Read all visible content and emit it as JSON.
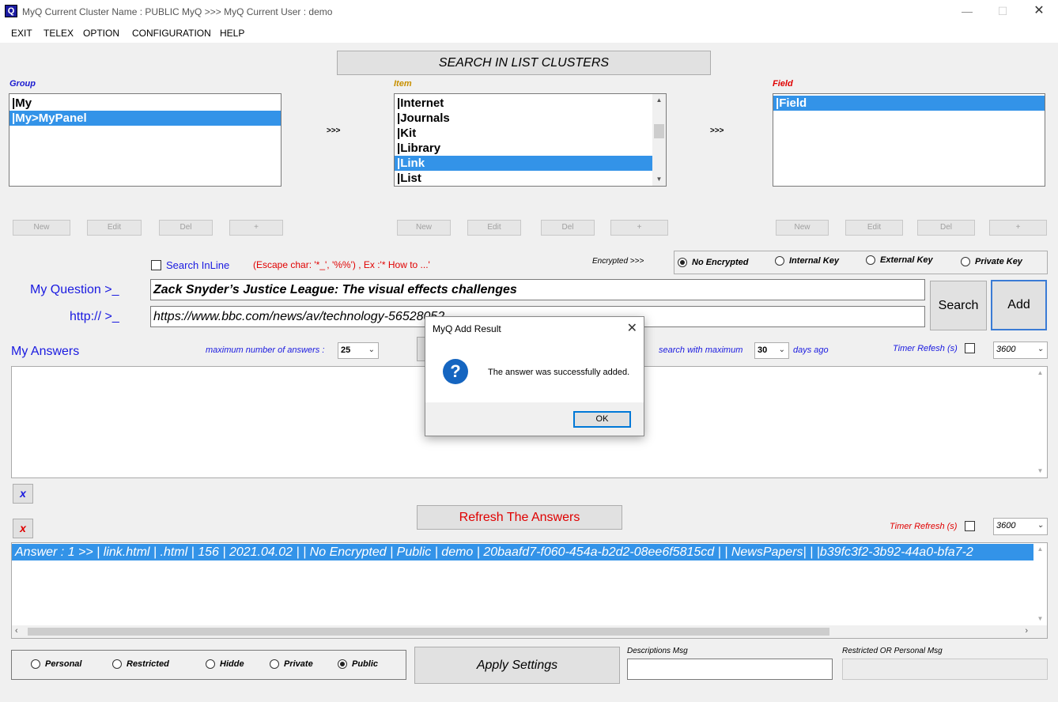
{
  "window": {
    "title": "MyQ Current Cluster Name : PUBLIC MyQ >>> MyQ Current User : demo",
    "app_icon": "Q"
  },
  "menu": [
    "EXIT",
    "TELEX",
    "OPTION",
    "CONFIGURATION",
    "HELP"
  ],
  "search_clusters_button": "SEARCH IN LIST CLUSTERS",
  "group": {
    "label": "Group",
    "items": [
      "|My",
      "|My>MyPanel"
    ],
    "selected_index": 1
  },
  "item": {
    "label": "Item",
    "items": [
      "|Internet",
      "|Journals",
      "|Kit",
      "|Library",
      "|Link",
      "|List"
    ],
    "selected_index": 4
  },
  "field": {
    "label": "Field",
    "items": [
      "|Field"
    ],
    "selected_index": 0
  },
  "arrow_text": ">>>",
  "crud_buttons": [
    "New",
    "Edit",
    "Del",
    "+"
  ],
  "search_inline": {
    "label": "Search InLine",
    "hint": "(Escape char: '*_', '%%') , Ex :'* How to ...'"
  },
  "encryption": {
    "label": "Encrypted >>>",
    "options": [
      "No Encrypted",
      "Internal Key",
      "External Key",
      "Private Key"
    ],
    "selected": "No Encrypted"
  },
  "question": {
    "label": "My Question >_",
    "value": "Zack Snyder’s Justice League: The visual effects challenges"
  },
  "url": {
    "label": "http:// >_",
    "value": "https://www.bbc.com/news/av/technology-56528052"
  },
  "buttons": {
    "search": "Search",
    "add": "Add",
    "refresh": "Refresh The Answers",
    "apply": "Apply Settings",
    "clear_x": "x"
  },
  "answers": {
    "title": "My Answers",
    "max_label": "maximum number of answers :",
    "max_value": "25",
    "search_max_label": "search with maximum",
    "search_max_value": "30",
    "days_label": "days ago",
    "timer_label": "Timer Refesh (s)",
    "timer_value": "3600"
  },
  "results": {
    "timer_label": "Timer Refresh (s)",
    "timer_value": "3600",
    "rows": [
      "Answer : 1 >> | link.html | .html | 156 | 2021.04.02 |  | No Encrypted | Public | demo | 20baafd7-f060-454a-b2d2-08ee6f5815cd |  | NewsPapers|   | |b39fc3f2-3b92-44a0-bfa7-2"
    ]
  },
  "visibility": {
    "options": [
      "Personal",
      "Restricted",
      "Hidde",
      "Private",
      "Public"
    ],
    "selected": "Public"
  },
  "descriptions_label": "Descriptions Msg",
  "restricted_label": "Restricted OR Personal Msg",
  "dialog": {
    "title": "MyQ Add Result",
    "message": "The answer was successfully added.",
    "ok": "OK"
  },
  "colors": {
    "selection": "#3393e8",
    "group_label": "#1a1ad0",
    "item_label": "#c89000",
    "field_label": "#e00000",
    "hint_red": "#e00000",
    "question_blue": "#1a1ae0"
  }
}
